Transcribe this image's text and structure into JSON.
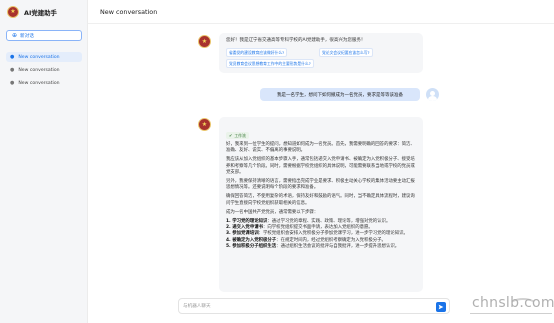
{
  "sidebar": {
    "brand_title": "AI党建助手",
    "new_chat_label": "新对话",
    "conversations": [
      "New conversation",
      "New conversation",
      "New conversation"
    ]
  },
  "header": {
    "title": "New conversation"
  },
  "chat": {
    "welcome": "您好！我是辽宁省交通高等专科学校的AI党建助手，很高兴为您服务！",
    "suggestions": [
      "省委党的建设教育应该做好什么?",
      "党论文会议纪要应该怎么写?",
      "党员教育会议思想教育工作中的主要形势是什么?"
    ],
    "user_message": "我是一名学生，想问下如何撤成为一名党员，要求是等等该准备",
    "tool_tag": "工作流",
    "answer_paragraphs": [
      "好，我来到一位学生的提问，想知道如何成为一名党员。首先，我需要明确的回答的要求：简洁、准确、友好、说实、不偏离的事要说明。",
      "我应该从加入党组织的基本步骤入手，通常包括递交入党申请书、被确定为入党积极分子、接受培养和考察等几个阶段。同时，需要根据学校党组织的具体说明，可能需要联系当地或学校的党员或党支部。",
      "另外，我要保持清晰的语言，需要指出完成学业是要求、积极主动关心学校的集体活动要主动汇报思想情况等。还要说明每个阶段的要求和准备。",
      "确保回答简洁，不使用复杂的术语，保持友好和鼓励的语气。同时，当不确定具体流程时，建议询问学生直接向学校党组织获取相关的信息。",
      "成为一名中国共产党党员，通常需要以下步骤："
    ],
    "answer_list": [
      {
        "title": "1. 学习党的理论知识",
        "text": "：通过学习党的章程、实践、政策、理论等，增强对党的认识。"
      },
      {
        "title": "2. 递交入党申请书",
        "text": "：向学校党组织提交书面申请，表达加入党组织的意愿。"
      },
      {
        "title": "3. 参加党课培训",
        "text": "：学校党组织会安排入党积极分子参加党课学习，进一步学习党的理论知识。"
      },
      {
        "title": "4. 被确定为入党积极分子",
        "text": "：在规定时间内，经过党组织考察确定为入党积极分子。"
      },
      {
        "title": "5. 参加积极分子组织生活",
        "text": "：通过组织生活会议的批评与自我批评，进一步提升思想认识。"
      }
    ]
  },
  "input": {
    "placeholder": "与机器人聊天"
  },
  "watermark": {
    "text": "chnslb.com"
  },
  "colors": {
    "accent": "#1a73e8",
    "sidebar_bg": "#f5f6f8",
    "bubble_bg": "#f5f6f8",
    "user_bubble": "#d9e6fb",
    "logo_red": "#a8322d"
  }
}
